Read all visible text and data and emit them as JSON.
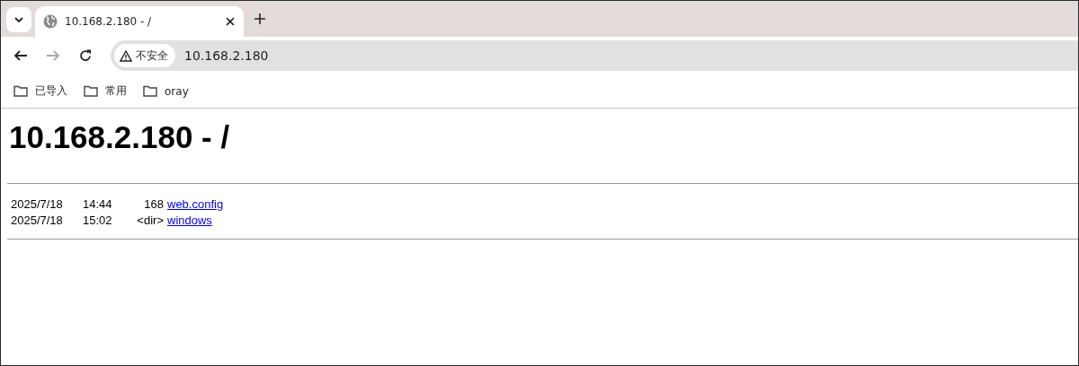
{
  "tab_strip": {
    "tabs": [
      {
        "title": "10.168.2.180 - /",
        "selected": true
      }
    ]
  },
  "toolbar": {
    "buttons": [
      {
        "kind": "back",
        "disabled": false
      },
      {
        "kind": "forward",
        "disabled": true
      },
      {
        "kind": "reload",
        "disabled": false
      }
    ],
    "security_chip": "不安全",
    "url": "10.168.2.180"
  },
  "bookmarks": [
    {
      "label": "已导入"
    },
    {
      "label": "常用"
    },
    {
      "label": "oray"
    }
  ],
  "page": {
    "heading": "10.168.2.180 - /",
    "entries": [
      {
        "date": "2025/7/18",
        "time": "14:44",
        "size": "168",
        "name": "web.config"
      },
      {
        "date": "2025/7/18",
        "time": "15:02",
        "size": "<dir>",
        "name": "windows"
      }
    ]
  }
}
